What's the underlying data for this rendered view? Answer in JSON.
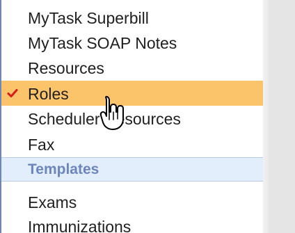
{
  "menu": {
    "items": [
      {
        "label": "MyTask Superbill"
      },
      {
        "label": "MyTask SOAP Notes"
      },
      {
        "label": "Resources"
      },
      {
        "label": "Roles",
        "selected": true
      },
      {
        "label": "Scheduler Resources"
      },
      {
        "label": "Fax"
      }
    ],
    "section": {
      "label": "Templates"
    },
    "section_items": [
      {
        "label": "Exams"
      },
      {
        "label": "Immunizations"
      }
    ]
  },
  "colors": {
    "selected_background": "#fbc46b",
    "check_color": "#d7191c",
    "section_text": "#6c85bd",
    "section_background": "#e3eefc",
    "menu_border": "#6f86b9"
  },
  "icons": {
    "selected_marker": "check-icon",
    "pointer": "cursor-icon"
  }
}
